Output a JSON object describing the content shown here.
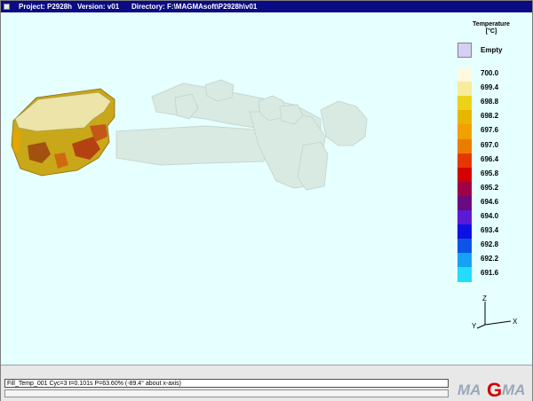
{
  "titlebar": {
    "project": "Project: P2928h",
    "version": "Version: v01",
    "directory": "Directory: F:\\MAGMAsoft\\P2928h\\v01"
  },
  "legend": {
    "title_line1": "Temperature",
    "title_line2": "[°C]",
    "empty_label": "Empty",
    "empty_color": "#d6d0f0",
    "entries": [
      {
        "label": "700.0",
        "color": "#fffadf"
      },
      {
        "label": "699.4",
        "color": "#f7ec9c"
      },
      {
        "label": "698.8",
        "color": "#ecd21a"
      },
      {
        "label": "698.2",
        "color": "#e6b600"
      },
      {
        "label": "697.6",
        "color": "#f2a000"
      },
      {
        "label": "697.0",
        "color": "#ec7c00"
      },
      {
        "label": "696.4",
        "color": "#e43800"
      },
      {
        "label": "695.8",
        "color": "#d20000"
      },
      {
        "label": "695.2",
        "color": "#a00046"
      },
      {
        "label": "694.6",
        "color": "#6a0a80"
      },
      {
        "label": "694.0",
        "color": "#5a1ad6"
      },
      {
        "label": "693.4",
        "color": "#0c12e2"
      },
      {
        "label": "692.8",
        "color": "#0c54e8"
      },
      {
        "label": "692.2",
        "color": "#16a2f4"
      },
      {
        "label": "691.6",
        "color": "#22dcfc"
      }
    ]
  },
  "axes": {
    "z": "Z",
    "y": "Y",
    "x": "X"
  },
  "status": {
    "text": "Fill_Temp_001 Cyc=3 t=0.101s P=63.60% (-89.4° about x-axis)"
  },
  "logo": {
    "text_left": "MA",
    "text_g": "G",
    "text_right": "MA",
    "color": "#d10000"
  }
}
